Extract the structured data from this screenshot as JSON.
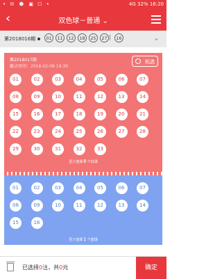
{
  "status_bar": {
    "left_icons": "• ✉ ⌚ ▣ ☐ •",
    "signal": "4G",
    "battery": "32%",
    "time": "16:20"
  },
  "header": {
    "title": "双色球－普通",
    "dropdown_icon": "chevron-down-icon",
    "back_icon": "back-arrow-icon",
    "menu_icon": "menu-icon"
  },
  "history": {
    "issue": "第2018016期",
    "red_balls": [
      "01",
      "11",
      "12",
      "18",
      "25",
      "27"
    ],
    "separator": "|",
    "blue_ball": "16"
  },
  "red_section": {
    "issue": "第2018017期",
    "deadline": "截止时间：2018-02-08 19:30",
    "machine_select": "机选",
    "balls": [
      "01",
      "02",
      "03",
      "04",
      "05",
      "06",
      "07",
      "08",
      "09",
      "10",
      "11",
      "12",
      "13",
      "14",
      "15",
      "16",
      "17",
      "18",
      "19",
      "20",
      "21",
      "22",
      "23",
      "24",
      "25",
      "26",
      "27",
      "28",
      "29",
      "30",
      "31",
      "32",
      "33"
    ],
    "hint_prefix": "至少选择",
    "hint_count": "6",
    "hint_suffix": "个红球"
  },
  "blue_section": {
    "balls": [
      "01",
      "02",
      "03",
      "04",
      "05",
      "06",
      "07",
      "08",
      "09",
      "10",
      "11",
      "12",
      "13",
      "14",
      "15",
      "16"
    ],
    "hint_prefix": "至少选择",
    "hint_count": "1",
    "hint_suffix": "个蓝球"
  },
  "bottom": {
    "summary_prefix": "已选择",
    "count": "0",
    "mid": "注，共",
    "amount": "0",
    "unit": "元",
    "confirm_label": "确定"
  },
  "colors": {
    "accent": "#e8383d",
    "red_area": "#f37474",
    "blue_area": "#7fa3f0"
  }
}
